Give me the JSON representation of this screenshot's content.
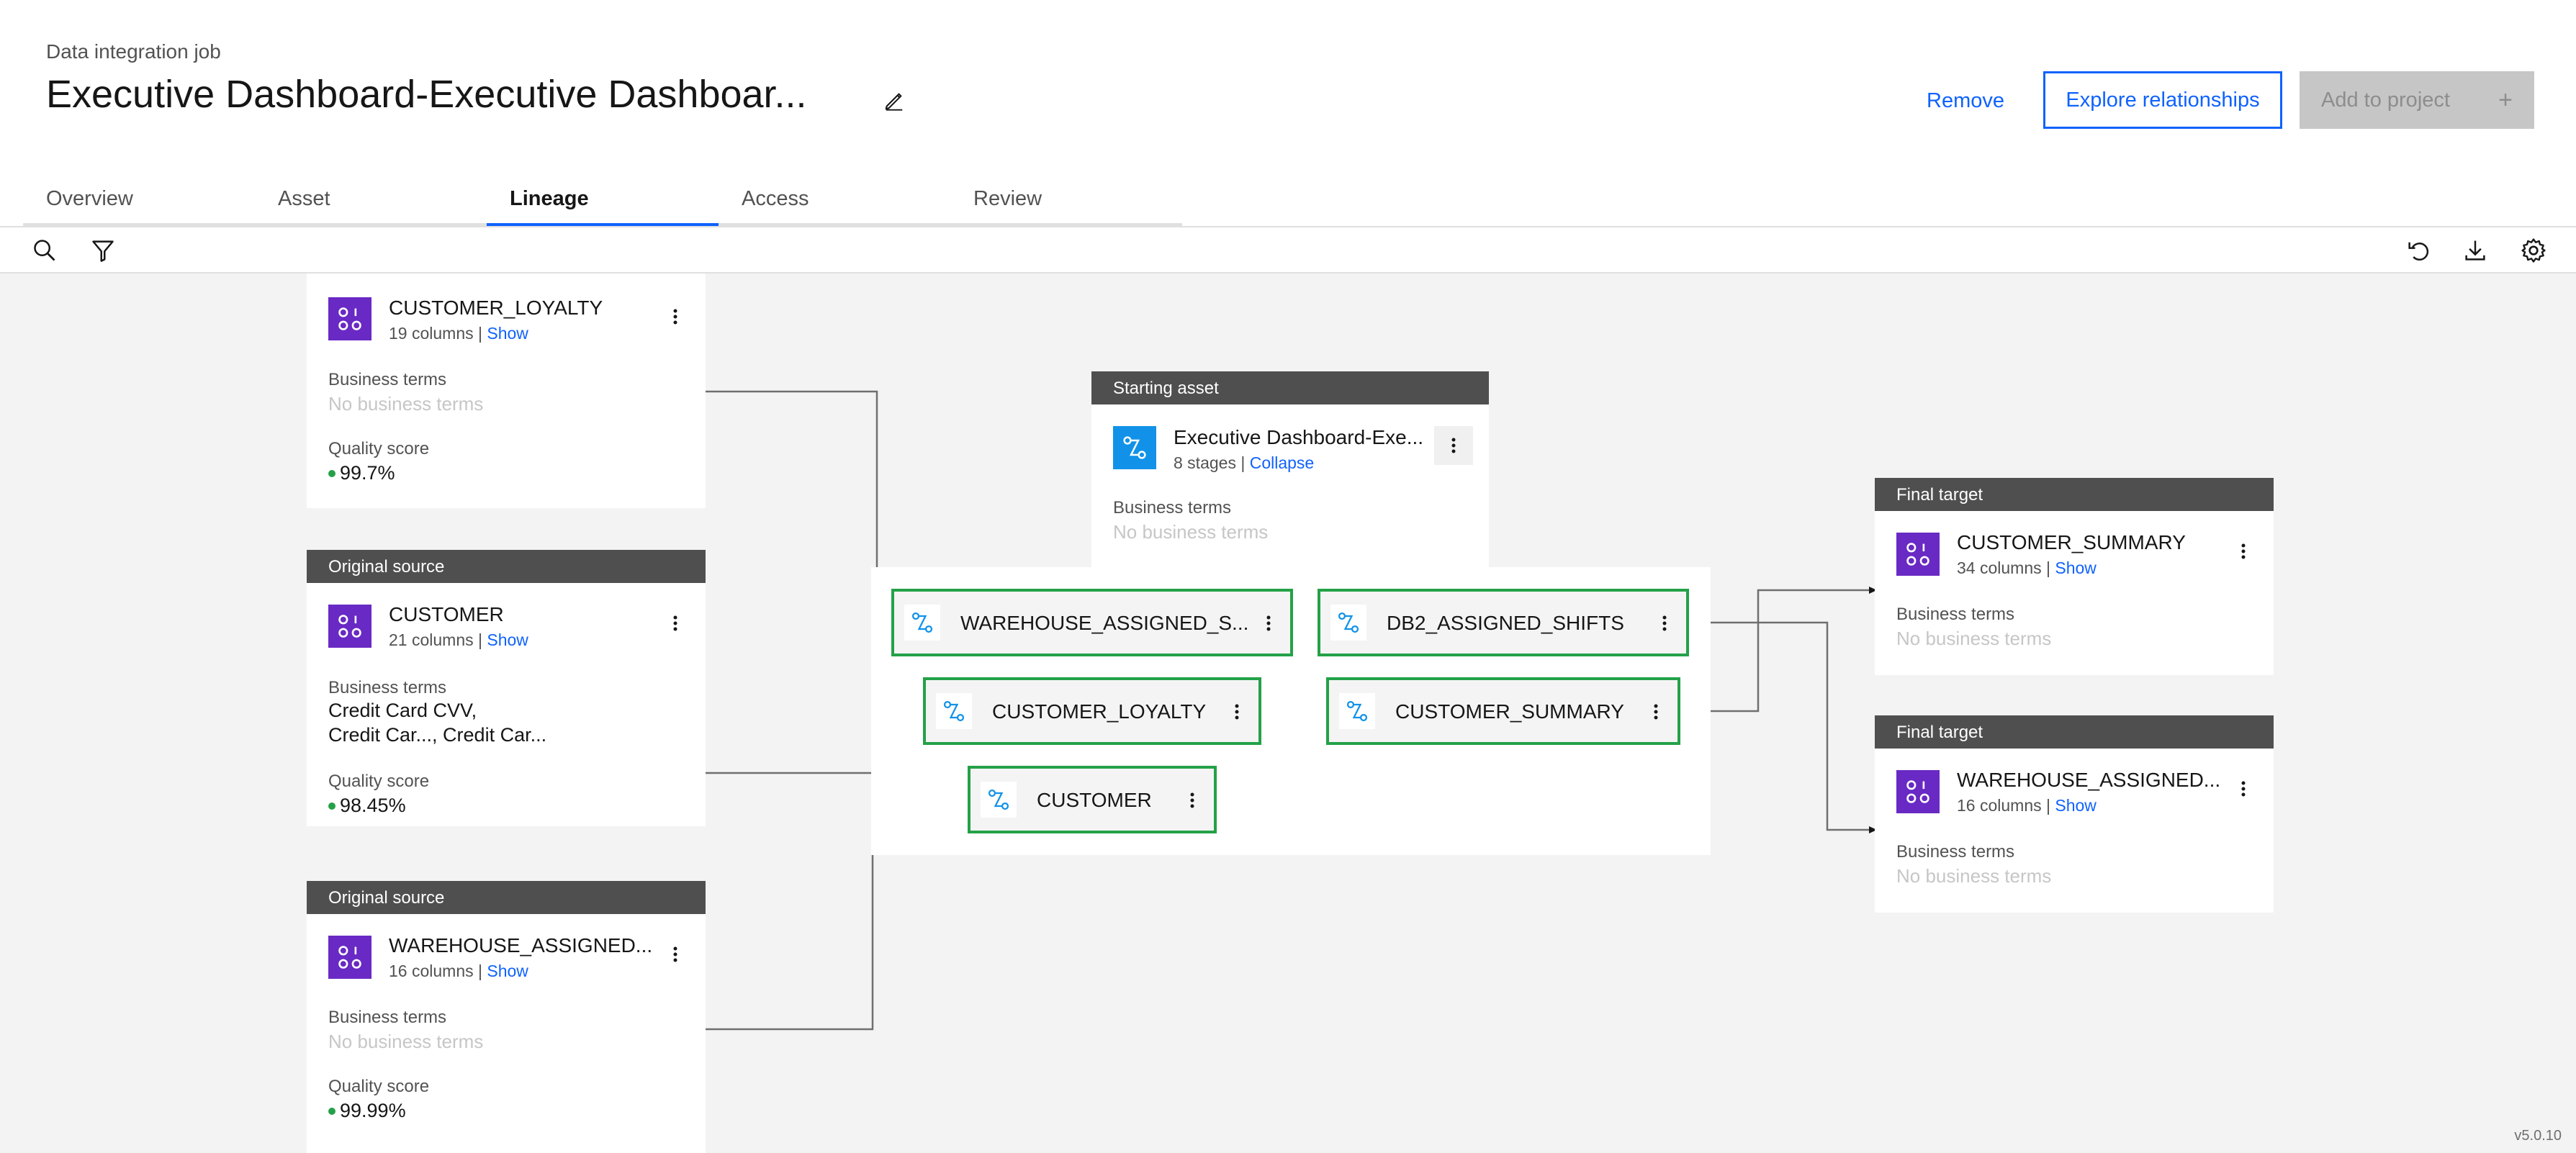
{
  "header": {
    "eyebrow": "Data integration job",
    "title": "Executive Dashboard-Executive Dashboar...",
    "remove_label": "Remove",
    "explore_label": "Explore relationships",
    "add_label": "Add to project",
    "add_plus": "+"
  },
  "tabs": [
    "Overview",
    "Asset",
    "Lineage",
    "Access",
    "Review"
  ],
  "active_tab": "Lineage",
  "toolbar": {
    "left_icons": [
      "search-icon",
      "filter-icon"
    ],
    "right_icons": [
      "reset-view-icon",
      "download-icon",
      "settings-icon"
    ]
  },
  "labels": {
    "business_terms": "Business terms",
    "no_business_terms": "No business terms",
    "quality_score": "Quality score",
    "original_source": "Original source",
    "final_target": "Final target",
    "starting_asset": "Starting asset",
    "show": "Show",
    "collapse": "Collapse"
  },
  "sources": [
    {
      "name": "CUSTOMER_LOYALTY",
      "meta": "19 columns | ",
      "terms": [],
      "quality": "99.7%"
    },
    {
      "header": "Original source",
      "name": "CUSTOMER",
      "meta": "21 columns | ",
      "terms": [
        "Credit Card CVV,",
        "Credit Car..., Credit Car..."
      ],
      "quality": "98.45%"
    },
    {
      "header": "Original source",
      "name": "WAREHOUSE_ASSIGNED...",
      "meta": "16 columns | ",
      "terms": [],
      "quality": "99.99%"
    }
  ],
  "starting_asset": {
    "header": "Starting asset",
    "name": "Executive Dashboard-Exe...",
    "meta": "8 stages | "
  },
  "stages": [
    {
      "name": "WAREHOUSE_ASSIGNED_S..."
    },
    {
      "name": "DB2_ASSIGNED_SHIFTS"
    },
    {
      "name": "CUSTOMER_LOYALTY"
    },
    {
      "name": "CUSTOMER_SUMMARY"
    },
    {
      "name": "CUSTOMER"
    }
  ],
  "targets": [
    {
      "header": "Final target",
      "name": "CUSTOMER_SUMMARY",
      "meta": "34 columns | "
    },
    {
      "header": "Final target",
      "name": "WAREHOUSE_ASSIGNED...",
      "meta": "16 columns | "
    }
  ],
  "colors": {
    "accent": "#0f62fe",
    "data_asset": "#6929c4",
    "job_asset": "#1192e8",
    "stage_border": "#24a148",
    "quality_dot": "#24a148",
    "card_header": "#4f4f4f"
  },
  "version": "v5.0.10"
}
